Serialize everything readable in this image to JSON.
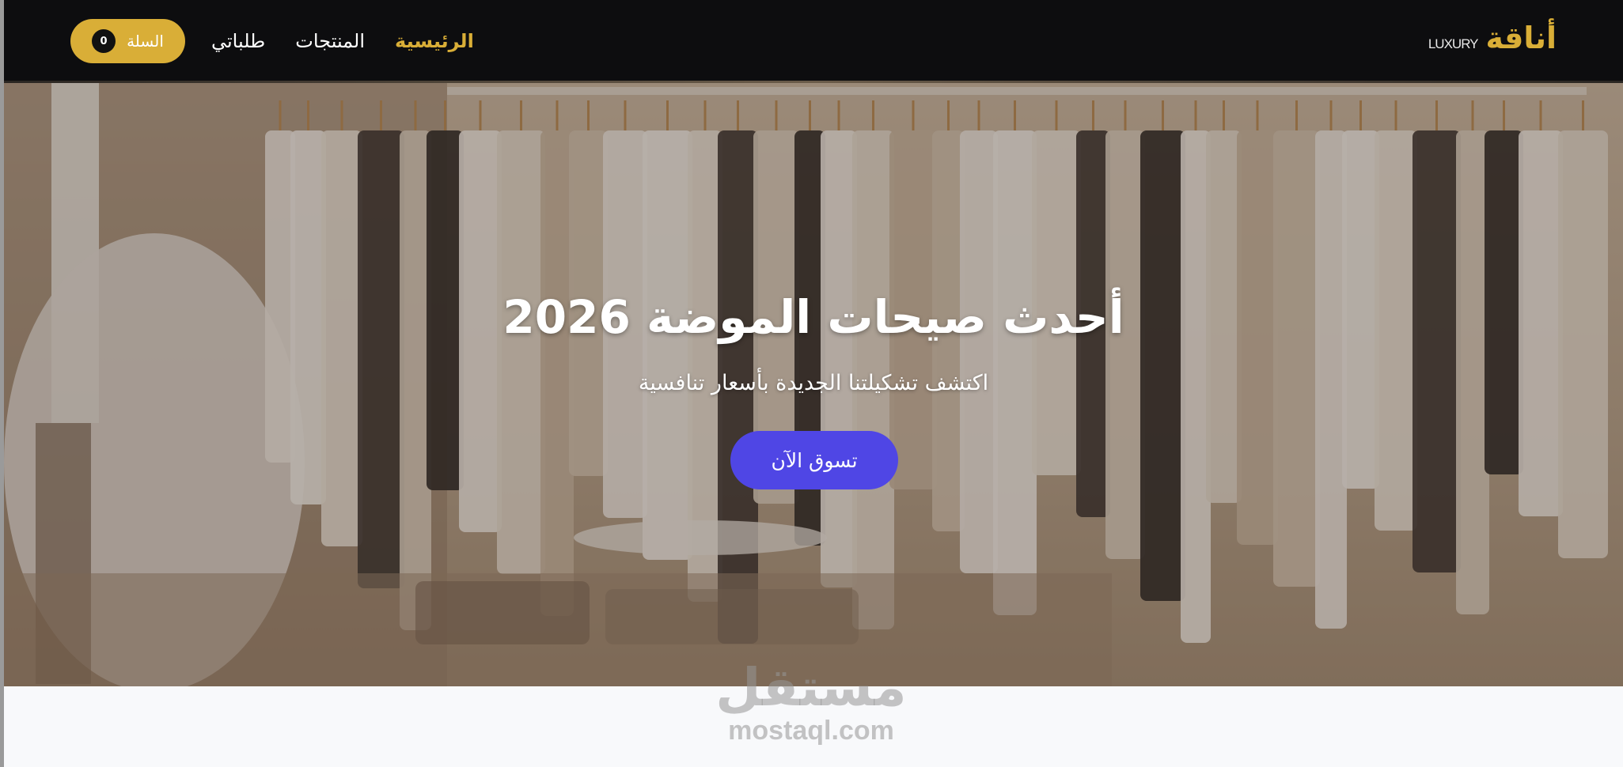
{
  "nav": {
    "brand_name": "أناقة",
    "brand_sub": "LUXURY",
    "links": [
      {
        "label": "طلباتي",
        "active": false
      },
      {
        "label": "المنتجات",
        "active": false
      },
      {
        "label": "الرئيسية",
        "active": true
      }
    ],
    "cart": {
      "label": "السلة",
      "count": "0"
    }
  },
  "hero": {
    "title": "أحدث صيحات الموضة 2026",
    "subtitle": "اكتشف تشكيلتنا الجديدة بأسعار تنافسية",
    "cta_label": "تسوق الآن",
    "background_image": "clothing-rack-photo"
  },
  "watermark": {
    "arabic": "مستقل",
    "latin": "mostaql.com"
  },
  "colors": {
    "nav_bg": "#0d0d0f",
    "accent_gold": "#d9ae37",
    "cta": "#4f46e5",
    "page_bg": "#f8f9fb"
  }
}
